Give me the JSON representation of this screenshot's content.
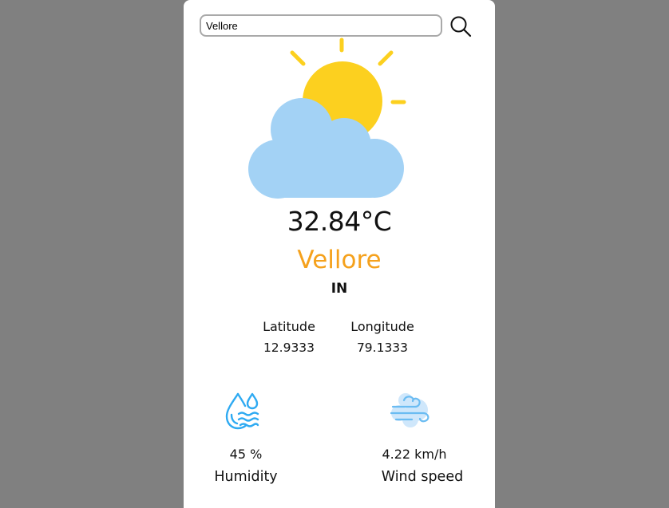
{
  "search": {
    "value": "Vellore",
    "icon": "search-icon"
  },
  "weather": {
    "icon": "partly-cloudy-icon",
    "temperature": "32.84°C",
    "city": "Vellore",
    "country": "IN"
  },
  "coordinates": {
    "latitude_label": "Latitude",
    "latitude_value": "12.9333",
    "longitude_label": "Longitude",
    "longitude_value": "79.1333"
  },
  "stats": {
    "humidity_icon": "humidity-icon",
    "humidity_value": "45 %",
    "humidity_label": "Humidity",
    "wind_icon": "wind-icon",
    "wind_value": "4.22 km/h",
    "wind_label": "Wind speed"
  },
  "colors": {
    "page_background": "#808080",
    "card_background": "#ffffff",
    "city_accent": "#f5a11c",
    "sun": "#fcd01f",
    "cloud": "#a3d2f5",
    "icon_blue": "#2eaaf2"
  }
}
